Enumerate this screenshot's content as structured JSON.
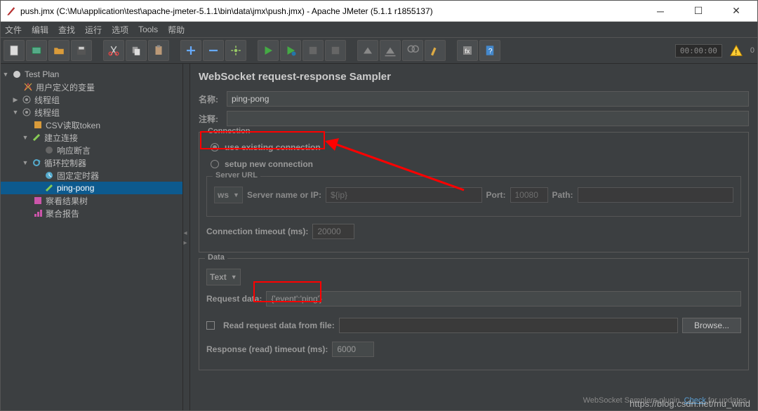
{
  "window": {
    "title": "push.jmx (C:\\Mu\\application\\test\\apache-jmeter-5.1.1\\bin\\data\\jmx\\push.jmx) - Apache JMeter (5.1.1 r1855137)",
    "timer": "00:00:00",
    "warn_count": "0"
  },
  "menu": [
    "文件",
    "编辑",
    "查找",
    "运行",
    "选项",
    "Tools",
    "帮助"
  ],
  "tree": {
    "root": "Test Plan",
    "n1": "用户定义的变量",
    "n2": "线程组",
    "n3": "线程组",
    "n4": "CSV读取token",
    "n5": "建立连接",
    "n6": "响应断言",
    "n7": "循环控制器",
    "n8": "固定定时器",
    "n9": "ping-pong",
    "n10": "察看结果树",
    "n11": "聚合报告"
  },
  "panel": {
    "title": "WebSocket request-response Sampler",
    "name_label": "名称:",
    "name_value": "ping-pong",
    "comment_label": "注释:",
    "comment_value": "",
    "conn": {
      "legend": "Connection",
      "opt_existing": "use existing connection",
      "opt_new": "setup new connection",
      "server_legend": "Server URL",
      "protocol": "ws",
      "server_label": "Server name or IP:",
      "server_value": "${ip}",
      "port_label": "Port:",
      "port_value": "10080",
      "path_label": "Path:",
      "path_value": "",
      "timeout_label": "Connection timeout (ms):",
      "timeout_value": "20000"
    },
    "data": {
      "legend": "Data",
      "type": "Text",
      "req_label": "Request data:",
      "req_value": "{'event':'ping'}",
      "file_label": "Read request data from file:",
      "file_value": "",
      "browse": "Browse...",
      "resp_label": "Response (read) timeout (ms):",
      "resp_value": "6000"
    },
    "footer_text": "WebSocket Samplers plugin. ",
    "footer_link": "Check",
    "footer_tail": " for updates."
  },
  "watermark": "https://blog.csdn.net/mu_wind"
}
